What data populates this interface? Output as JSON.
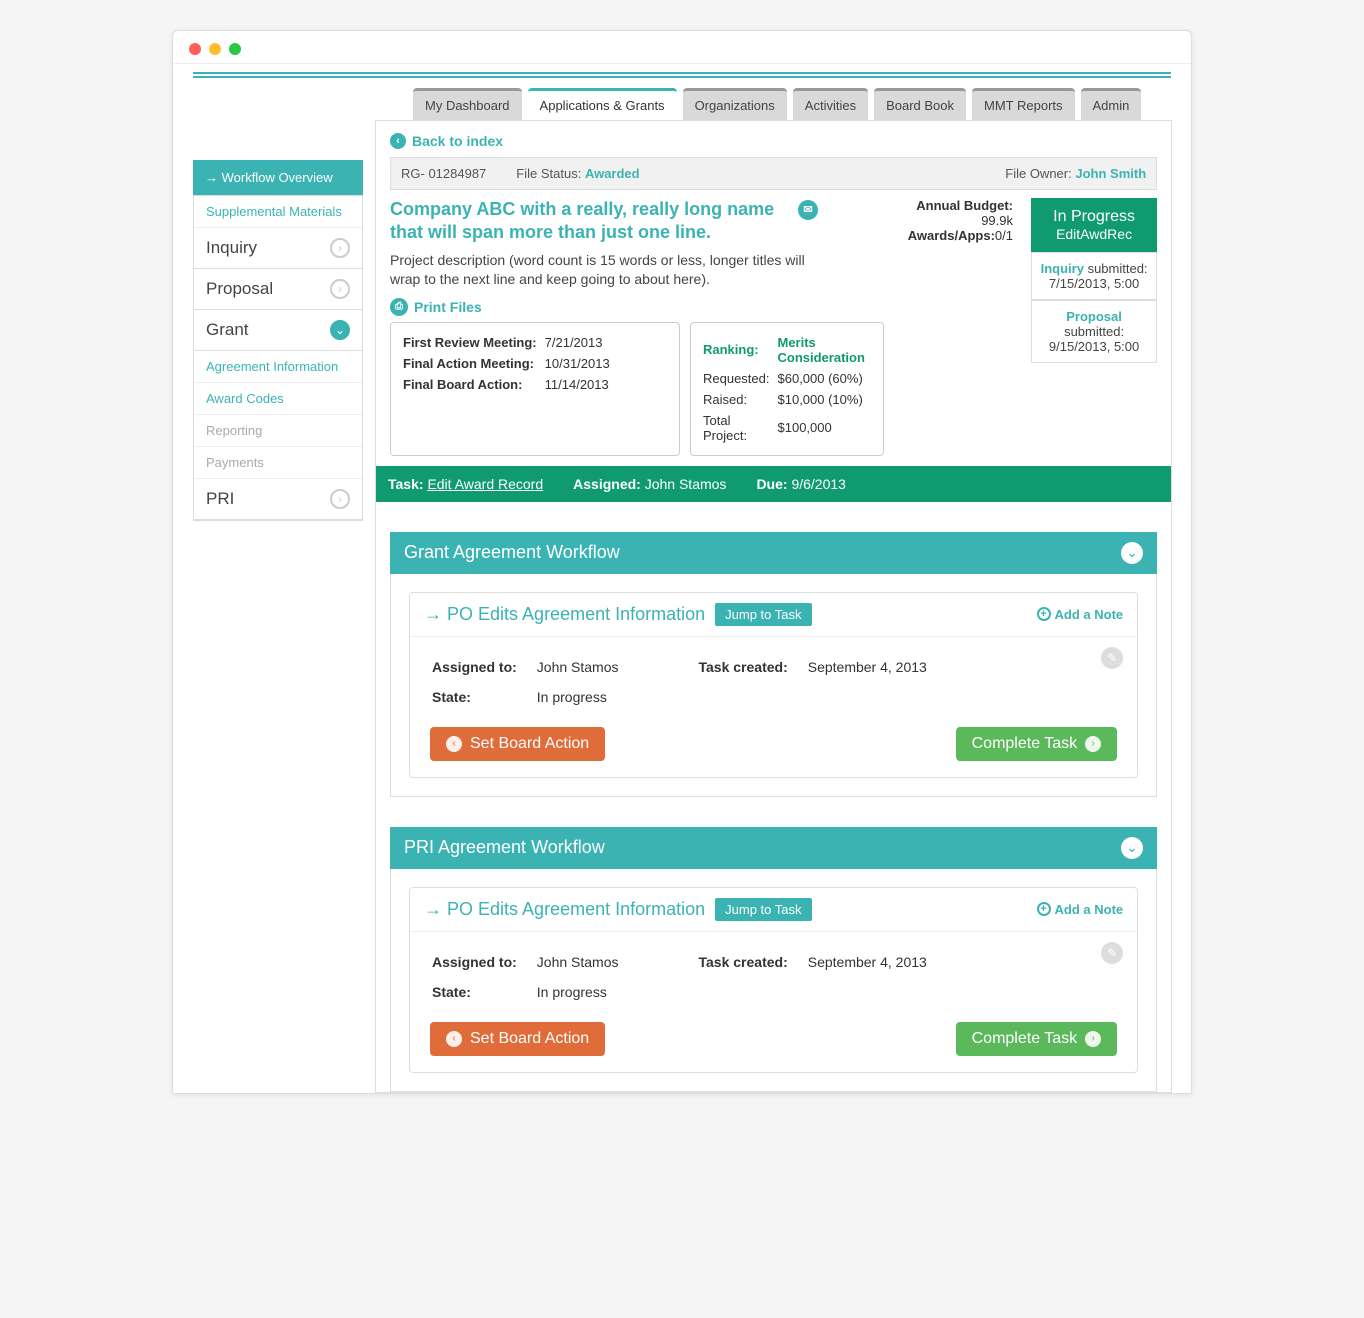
{
  "topTabs": [
    "My Dashboard",
    "Applications & Grants",
    "Organizations",
    "Activities",
    "Board Book",
    "MMT Reports",
    "Admin"
  ],
  "activeTabIndex": 1,
  "back": "Back to index",
  "sidebar": {
    "header": "Workflow Overview",
    "supplemental": "Supplemental Materials",
    "stages": [
      {
        "label": "Inquiry",
        "active": false
      },
      {
        "label": "Proposal",
        "active": false
      },
      {
        "label": "Grant",
        "active": true
      }
    ],
    "grantLinks": [
      {
        "label": "Agreement Information",
        "muted": false
      },
      {
        "label": "Award Codes",
        "muted": false
      },
      {
        "label": "Reporting",
        "muted": true
      },
      {
        "label": "Payments",
        "muted": true
      }
    ],
    "pri": "PRI"
  },
  "fileBar": {
    "refLabel": "RG- 01284987",
    "statusLabel": "File Status:",
    "statusValue": "Awarded",
    "ownerLabel": "File Owner:",
    "ownerValue": "John Smith"
  },
  "title": "Company ABC with a really, really long name that will span more than just one line.",
  "description": "Project description (word count is 15 words or less, longer titles will wrap to the next line and keep going to about here).",
  "printFiles": "Print Files",
  "budget": {
    "annualLabel": "Annual Budget:",
    "annualValue": "99.9k",
    "awardsLabel": "Awards/Apps:",
    "awardsValue": "0/1"
  },
  "status": {
    "main": "In Progress",
    "sub": "EditAwdRec",
    "inquiry": {
      "label": "Inquiry",
      "text": "submitted:",
      "date": "7/15/2013, 5:00"
    },
    "proposal": {
      "label": "Proposal",
      "text": "submitted:",
      "date": "9/15/2013, 5:00"
    }
  },
  "meetings": [
    {
      "label": "First Review Meeting:",
      "value": "7/21/2013"
    },
    {
      "label": "Final Action Meeting:",
      "value": "10/31/2013"
    },
    {
      "label": "Final Board Action:",
      "value": "11/14/2013"
    }
  ],
  "ranking": {
    "title": "Ranking:",
    "titleVal": "Merits Consideration",
    "rows": [
      {
        "label": "Requested:",
        "value": "$60,000 (60%)"
      },
      {
        "label": "Raised:",
        "value": "$10,000 (10%)"
      },
      {
        "label": "Total Project:",
        "value": "$100,000"
      }
    ]
  },
  "taskBar": {
    "taskLabel": "Task:",
    "taskValue": "Edit Award Record",
    "assignedLabel": "Assigned:",
    "assignedValue": "John Stamos",
    "dueLabel": "Due:",
    "dueValue": "9/6/2013"
  },
  "workflows": [
    {
      "title": "Grant Agreement Workflow",
      "task": {
        "title": "PO Edits Agreement Information",
        "jump": "Jump to Task",
        "addNote": "Add a Note",
        "assignedLabel": "Assigned to:",
        "assignedValue": "John Stamos",
        "createdLabel": "Task created:",
        "createdValue": "September 4, 2013",
        "stateLabel": "State:",
        "stateValue": "In progress",
        "boardAction": "Set Board Action",
        "complete": "Complete Task"
      }
    },
    {
      "title": "PRI Agreement Workflow",
      "task": {
        "title": "PO Edits Agreement Information",
        "jump": "Jump to Task",
        "addNote": "Add a Note",
        "assignedLabel": "Assigned to:",
        "assignedValue": "John Stamos",
        "createdLabel": "Task created:",
        "createdValue": "September 4, 2013",
        "stateLabel": "State:",
        "stateValue": "In progress",
        "boardAction": "Set Board Action",
        "complete": "Complete Task"
      }
    }
  ]
}
